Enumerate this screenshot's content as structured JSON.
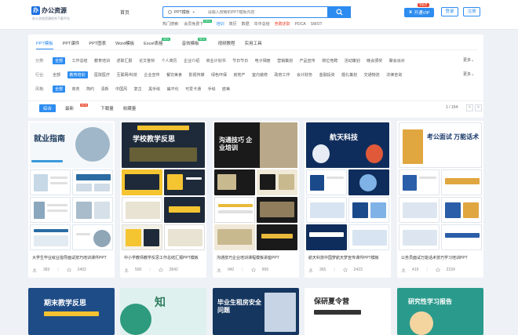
{
  "brand": {
    "logo_mark": "办",
    "name": "办公资源",
    "slogan": "办公文档资源综合下载平台"
  },
  "nav": {
    "home": "首页"
  },
  "search": {
    "category": "PPT模板",
    "placeholder": "请输入搜索的PPT模板内容"
  },
  "hot": {
    "label": "热门搜索:",
    "items": [
      "会员免费下",
      "培训",
      "简历",
      "数据",
      "年中总结",
      "竞聘述职",
      "PDCA",
      "SWOT"
    ],
    "tag": "NEW"
  },
  "header": {
    "vip_label": "开通VIP",
    "vip_badge": "领会员",
    "login": "登录",
    "register": "注册"
  },
  "tabs": [
    {
      "label": "PPT模板",
      "active": true
    },
    {
      "label": "PPT课件"
    },
    {
      "label": "PPT图表"
    },
    {
      "label": "Word模板"
    },
    {
      "label": "Excel表格",
      "badge": "NEW"
    },
    {
      "label": "音效模板",
      "badge": "NEW"
    },
    {
      "label": "视频教程"
    },
    {
      "label": "实用工具"
    }
  ],
  "filters": {
    "category": {
      "label": "分类:",
      "options": [
        "全部",
        "工作总结",
        "教育培训",
        "述职汇报",
        "论文答辩",
        "个人简历",
        "企业介绍",
        "商业计划书",
        "节日节日",
        "电子相册",
        "营销策划",
        "产品宣传",
        "岗位竞聘",
        "活动策划",
        "晚会颁奖",
        "聚会派对"
      ],
      "more": "更多"
    },
    "industry": {
      "label": "行业:",
      "options": [
        "全部",
        "教育培训",
        "医院医疗",
        "互联网/科技",
        "企业宣传",
        "餐饮美食",
        "影视传媒",
        "绿色环保",
        "房地产",
        "室内装修",
        "政府工作",
        "会计财务",
        "金融投资",
        "婚礼策划",
        "交通物流",
        "法律咨询"
      ],
      "more": "更多"
    },
    "style": {
      "label": "风格:",
      "options": [
        "全部",
        "商务",
        "简约",
        "清新",
        "中国风",
        "复古",
        "黑手绘",
        "扁平化",
        "可爱卡通",
        "手绘",
        "欧美"
      ]
    }
  },
  "sort": {
    "comprehensive": "综合",
    "latest": "最新",
    "latest_badge": "NEW",
    "downloads": "下载量",
    "favorites": "收藏量"
  },
  "pagination": {
    "info": "1 / 154",
    "prev": "<",
    "next": ">"
  },
  "cards": [
    {
      "title": "大学生毕业就业指导面试技巧培训课件PPT",
      "downloads": "383",
      "favorites": "2402",
      "cover": "就业指南"
    },
    {
      "title": "中小学教师教学反思工作总结汇报PPT模板",
      "downloads": "500",
      "favorites": "2842",
      "cover": "学校教学反思"
    },
    {
      "title": "沟通技巧企业培训课程模板讲座PPT",
      "downloads": "942",
      "favorites": "999",
      "cover": "沟通技巧 企业培训"
    },
    {
      "title": "航天科技中国梦航天梦宣传课件PPT模板",
      "downloads": "365",
      "favorites": "2423",
      "cover": "航天科技"
    },
    {
      "title": "公务员面试万能话术技巧学习培训PPT",
      "downloads": "419",
      "favorites": "2159",
      "cover": "考公面试 万能话术"
    }
  ],
  "row2": [
    "期末教学反思",
    "知",
    "毕业生租房安全问题",
    "保研夏令营",
    "研究性学习报告"
  ],
  "colors": {
    "accent": "#2d8cf0",
    "page_bg": "#eef1f6",
    "new_badge": "#21b96a",
    "red": "#e8452c"
  }
}
